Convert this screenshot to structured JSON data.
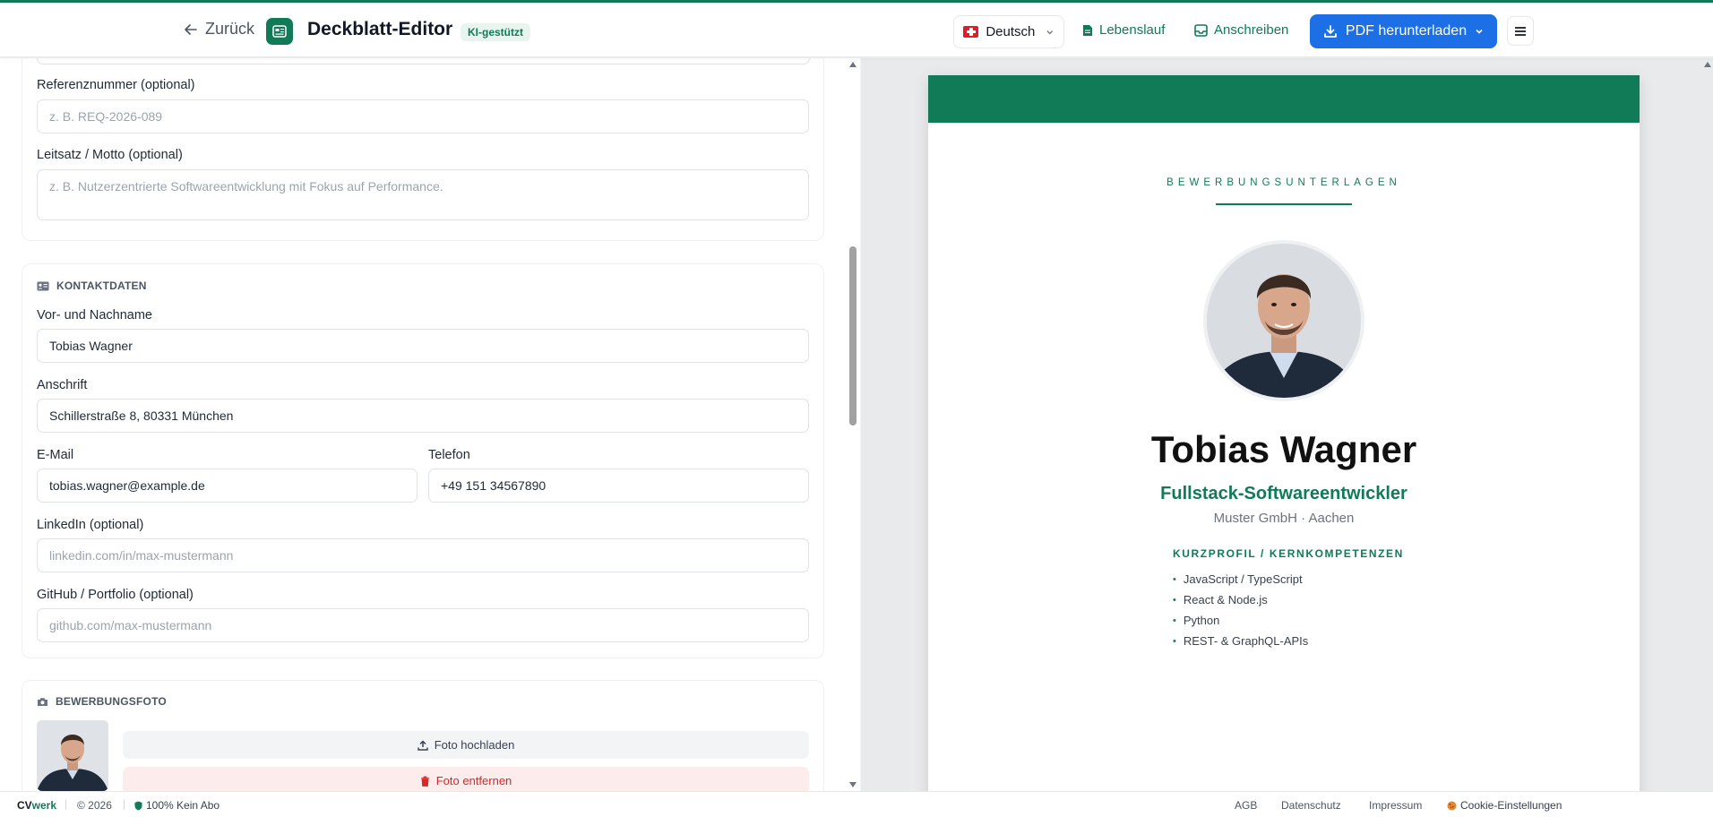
{
  "header": {
    "back_label": "Zurück",
    "title": "Deckblatt-Editor",
    "badge": "KI-gestützt",
    "language": "Deutsch",
    "link_cv": "Lebenslauf",
    "link_letter": "Anschreiben",
    "pdf_button": "PDF herunterladen",
    "accent_color": "#117a56",
    "primary_color": "#1d6fe6"
  },
  "editor": {
    "reference": {
      "label": "Referenznummer (optional)",
      "placeholder": "z. B. REQ-2026-089"
    },
    "motto": {
      "label": "Leitsatz / Motto (optional)",
      "placeholder": "z. B. Nutzerzentrierte Softwareentwicklung mit Fokus auf Performance."
    },
    "contact": {
      "section_title": "KONTAKTDATEN",
      "name": {
        "label": "Vor- und Nachname",
        "value": "Tobias Wagner"
      },
      "address": {
        "label": "Anschrift",
        "value": "Schillerstraße 8, 80331 München"
      },
      "email": {
        "label": "E-Mail",
        "value": "tobias.wagner@example.de"
      },
      "phone": {
        "label": "Telefon",
        "value": "+49 151 34567890"
      },
      "linkedin": {
        "label": "LinkedIn (optional)",
        "placeholder": "linkedin.com/in/max-mustermann"
      },
      "github": {
        "label": "GitHub / Portfolio (optional)",
        "placeholder": "github.com/max-mustermann"
      }
    },
    "photo": {
      "section_title": "BEWERBUNGSFOTO",
      "upload_label": "Foto hochladen",
      "remove_label": "Foto entfernen"
    }
  },
  "preview": {
    "eyebrow": "BEWERBUNGSUNTERLAGEN",
    "name": "Tobias Wagner",
    "role": "Fullstack-Softwareentwickler",
    "company": "Muster GmbH · Aachen",
    "section_title": "KURZPROFIL / KERNKOMPETENZEN",
    "skills": [
      "JavaScript / TypeScript",
      "React & Node.js",
      "Python",
      "REST- & GraphQL-APIs"
    ]
  },
  "footer": {
    "brand_cv": "CV",
    "brand_werk": "werk",
    "copyright": "© 2026",
    "no_subscription": "100% Kein Abo",
    "links": [
      "AGB",
      "Datenschutz",
      "Impressum"
    ],
    "cookie": "Cookie-Einstellungen"
  }
}
